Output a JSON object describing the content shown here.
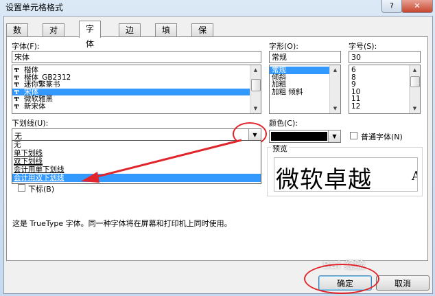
{
  "window": {
    "title": "设置单元格格式",
    "help": "?",
    "close": "✕"
  },
  "tabs": [
    {
      "label": "数字"
    },
    {
      "label": "对齐"
    },
    {
      "label": "字体"
    },
    {
      "label": "边框"
    },
    {
      "label": "填充"
    },
    {
      "label": "保护"
    }
  ],
  "font": {
    "label": "字体(F):",
    "value": "宋体",
    "items": [
      "楷体",
      "楷体_GB2312",
      "迷你繁篆书",
      "宋体",
      "微软雅黑",
      "新宋体"
    ],
    "icon_glyph": "Ͳ"
  },
  "style": {
    "label": "字形(O):",
    "value": "常规",
    "items": [
      "常规",
      "倾斜",
      "加粗",
      "加粗 倾斜"
    ]
  },
  "size": {
    "label": "字号(S):",
    "value": "30",
    "items": [
      "6",
      "8",
      "9",
      "10",
      "11",
      "12"
    ]
  },
  "underline": {
    "label": "下划线(U):",
    "value": "无",
    "options": [
      "无",
      "单下划线",
      "双下划线",
      "会计用单下划线",
      "会计用双下划线"
    ],
    "arrow": "▼"
  },
  "color": {
    "label": "颜色(C):",
    "value_color": "#000000",
    "arrow": "▼"
  },
  "normal_font": {
    "label": "普通字体(N)"
  },
  "effects": {
    "subscript_partial": "下标(B)"
  },
  "preview": {
    "label": "预览",
    "text": "微软卓越",
    "tail": "A"
  },
  "description": "这是 TrueType 字体。同一种字体将在屏幕和打印机上同时使用。",
  "buttons": {
    "ok": "确定",
    "cancel": "取消"
  },
  "watermark": "Bai 经验",
  "colors": {
    "selection": "#3399ff",
    "annotation": "#e0252c"
  }
}
